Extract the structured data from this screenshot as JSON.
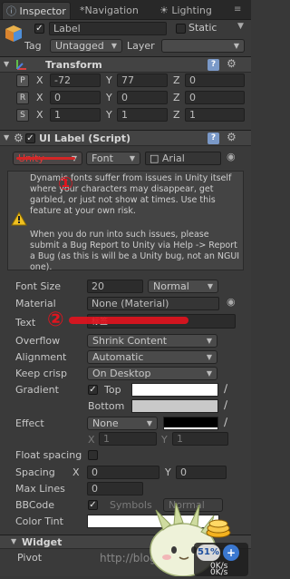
{
  "tabs": [
    {
      "label": "Inspector",
      "icon": "info-icon"
    },
    {
      "label": "Navigation",
      "icon": "navigation-icon"
    },
    {
      "label": "Lighting",
      "icon": "lighting-icon"
    }
  ],
  "object": {
    "name": "Label",
    "static_label": "Static",
    "tag_label": "Tag",
    "tag_value": "Untagged",
    "layer_label": "Layer",
    "layer_value": ""
  },
  "transform": {
    "title": "Transform",
    "rows": [
      {
        "btn": "P",
        "x": "-72",
        "y": "77",
        "z": "0"
      },
      {
        "btn": "R",
        "x": "0",
        "y": "0",
        "z": "0"
      },
      {
        "btn": "S",
        "x": "1",
        "y": "1",
        "z": "1"
      }
    ],
    "axis_x": "X",
    "axis_y": "Y",
    "axis_z": "Z"
  },
  "uilabel": {
    "title": "UI Label (Script)",
    "font_type_1": "Unity",
    "font_type_2": "Font",
    "font_name": "Arial",
    "warning": "Dynamic fonts suffer from issues in Unity itself where your characters may disappear, get garbled, or just not show at times. Use this feature at your own risk.",
    "warning2": "When you do run into such issues, please submit a Bug Report to Unity via Help -> Report a Bug (as this is will be a Unity bug, not an NGUI one).",
    "font_size_label": "Font Size",
    "font_size_value": "20",
    "font_style": "Normal",
    "material_label": "Material",
    "material_value": "None (Material)",
    "text_label": "Text",
    "text_value": "标签",
    "overflow_label": "Overflow",
    "overflow_value": "Shrink Content",
    "alignment_label": "Alignment",
    "alignment_value": "Automatic",
    "keep_crisp_label": "Keep crisp",
    "keep_crisp_value": "On Desktop",
    "gradient_label": "Gradient",
    "gradient_top": "Top",
    "gradient_bottom": "Bottom",
    "effect_label": "Effect",
    "effect_value": "None",
    "effect_x": "1",
    "effect_y": "1",
    "float_spacing_label": "Float spacing",
    "spacing_label": "Spacing",
    "spacing_x": "0",
    "spacing_y": "0",
    "max_lines_label": "Max Lines",
    "max_lines_value": "0",
    "bbcode_label": "BBCode",
    "symbols_label": "Symbols",
    "symbols_value": "Normal",
    "color_tint_label": "Color Tint"
  },
  "widget": {
    "title": "Widget",
    "pivot_label": "Pivot"
  },
  "annotations": {
    "one": "①",
    "two": "②"
  },
  "overlay": {
    "percent": "51%",
    "speed1": "0K/s",
    "speed2": "0K/s",
    "watermark": "http://blog.csdn.net/"
  },
  "colors": {
    "annotation_red": "#e0141e",
    "unity_font_red": "#d42626",
    "gradient_bottom": "#c9c9c9"
  }
}
